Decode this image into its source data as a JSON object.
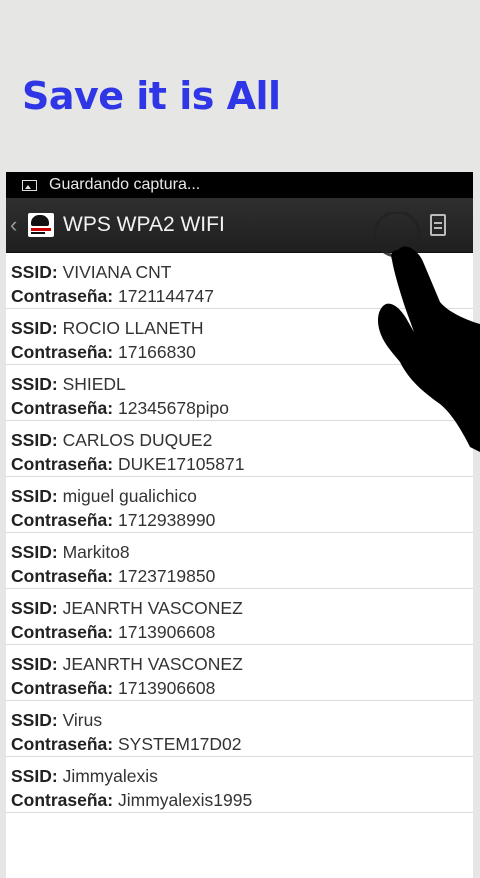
{
  "headline": "Save it is All",
  "status_bar": {
    "icon": "image-icon",
    "text": "Guardando captura..."
  },
  "action_bar": {
    "back_icon": "chevron-left-icon",
    "title": "WPS WPA2 WIFI",
    "action_icon": "list-icon"
  },
  "labels": {
    "ssid": "SSID:",
    "password": "Contraseña:"
  },
  "networks": [
    {
      "ssid": "VIVIANA CNT",
      "password": "1721144747"
    },
    {
      "ssid": "ROCIO LLANETH",
      "password": "17166830"
    },
    {
      "ssid": "SHIEDL",
      "password": "12345678pipo"
    },
    {
      "ssid": "CARLOS DUQUE2",
      "password": "DUKE17105871"
    },
    {
      "ssid": "miguel gualichico",
      "password": "1712938990"
    },
    {
      "ssid": "Markito8",
      "password": "1723719850"
    },
    {
      "ssid": "JEANRTH VASCONEZ",
      "password": "1713906608"
    },
    {
      "ssid": "JEANRTH VASCONEZ",
      "password": "1713906608"
    },
    {
      "ssid": "Virus",
      "password": "SYSTEM17D02"
    },
    {
      "ssid": "Jimmyalexis",
      "password": "Jimmyalexis1995"
    }
  ]
}
